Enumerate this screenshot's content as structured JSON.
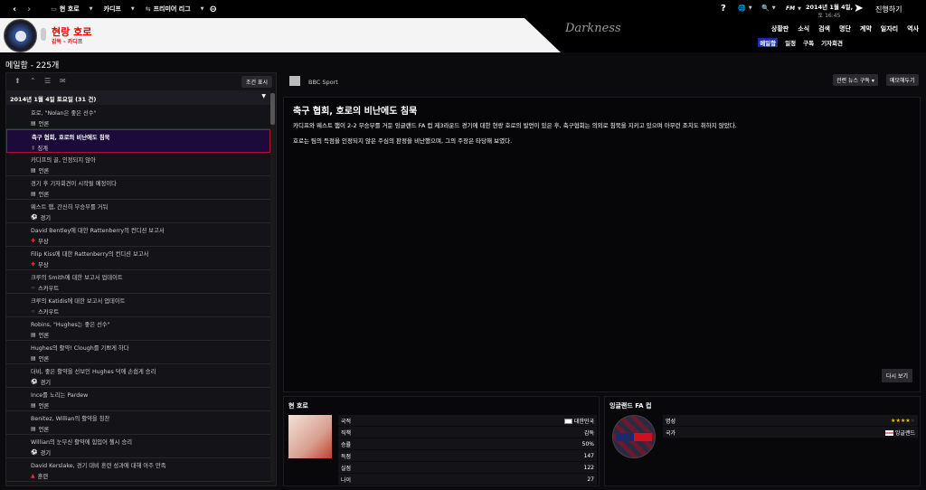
{
  "topbar": {
    "team": "현 호로",
    "club": "카디프",
    "league": "프리미어 리그",
    "date": "2014년 1월 4일,",
    "time": "토 16:45",
    "continue": "진행하기",
    "fm": "FM"
  },
  "header": {
    "manager_name": "현랑 호로",
    "manager_sub": "감독 - 카디프",
    "skin": "Darkness",
    "nav": [
      "상황판",
      "소식",
      "검색",
      "명단",
      "계약",
      "일자리",
      "역사"
    ],
    "subnav": [
      "메일함",
      "일정",
      "구독",
      "기자회견"
    ]
  },
  "inbox": {
    "title": "메일함 - 225개",
    "condition_button": "조건 표시",
    "date_header": "2014년 1월 4일 토요일 (31 건)",
    "items": [
      {
        "title": "호로, \"Nolan은 좋은 선수\"",
        "category": "언론",
        "icon": "newspaper"
      },
      {
        "title": "축구 협회, 호로의 비난에도 침묵",
        "category": "징계",
        "icon": "card",
        "selected": true
      },
      {
        "title": "카디프의 골, 인정되지 않아",
        "category": "언론",
        "icon": "newspaper"
      },
      {
        "title": "경기 후 기자회견이 시작될 예정이다",
        "category": "언론",
        "icon": "newspaper"
      },
      {
        "title": "웨스트 햄, 간신히 무승부를 거둬",
        "category": "경기",
        "icon": "ball"
      },
      {
        "title": "David Bentley에 대한 Rattenberry의 컨디션 보고서",
        "category": "부상",
        "icon": "medical"
      },
      {
        "title": "Filip Kiss에 대한 Rattenberry의 컨디션 보고서",
        "category": "부상",
        "icon": "medical"
      },
      {
        "title": "크루의 Smith에 대한 보고서 업데이트",
        "category": "스카우트",
        "icon": "binoculars"
      },
      {
        "title": "크루의 Katidis에 대한 보고서 업데이트",
        "category": "스카우트",
        "icon": "binoculars"
      },
      {
        "title": "Robins, \"Hughes는 좋은 선수\"",
        "category": "언론",
        "icon": "newspaper"
      },
      {
        "title": "Hughes의 활약! Clough를 기쁘게 하다",
        "category": "언론",
        "icon": "newspaper"
      },
      {
        "title": "더비, 좋은 활약을 선보인 Hughes 덕에 손쉽게 승리",
        "category": "경기",
        "icon": "ball"
      },
      {
        "title": "Ince를 노리는 Pardew",
        "category": "언론",
        "icon": "newspaper"
      },
      {
        "title": "Benitez, Willian의 활약을 칭찬",
        "category": "언론",
        "icon": "newspaper"
      },
      {
        "title": "Willian의 눈부신 활약에 힘입어 첼시 승리",
        "category": "경기",
        "icon": "ball"
      },
      {
        "title": "David Kerslake, 경기 대비 훈련 성과에 대해 아주 만족",
        "category": "훈련",
        "icon": "training"
      }
    ]
  },
  "article": {
    "source": "BBC Sport",
    "subscribe_button": "관련 뉴스 구독",
    "memo_button": "메모해두기",
    "title": "축구 협회, 호로의 비난에도 침묵",
    "paragraphs": [
      "카디프와 웨스트 햄이 2-2 무승부를 거둔 잉글랜드 FA 컵 제3라운드 경기에 대한 현랑 호로의 발언이 있은 후, 축구협회는 의외로 침묵을 지키고 있으며 아무런 조치도 취하지 않았다.",
      "호로는 팀의 득점을 인정되지 않은 주심의 판정을 비난했으며, 그의 주장은 타당해 보였다."
    ],
    "replay_button": "다시 보기"
  },
  "manager_card": {
    "title": "현 호로",
    "rows": [
      [
        "국적",
        "대한민국"
      ],
      [
        "직책",
        "감독"
      ],
      [
        "승률",
        "50%"
      ],
      [
        "득점",
        "147"
      ],
      [
        "실점",
        "122"
      ],
      [
        "나이",
        "27"
      ]
    ]
  },
  "competition_card": {
    "title": "잉글랜드 FA 컵",
    "reputation_label": "명성",
    "reputation_stars": 3.5,
    "reputation_max": 5,
    "nation_label": "국가",
    "nation": "잉글랜드"
  },
  "colors": {
    "accent_red": "#e00000",
    "selected_bg": "#1c0a3a",
    "selected_border": "#b01030",
    "subnav_selected": "#1a2aa8"
  }
}
